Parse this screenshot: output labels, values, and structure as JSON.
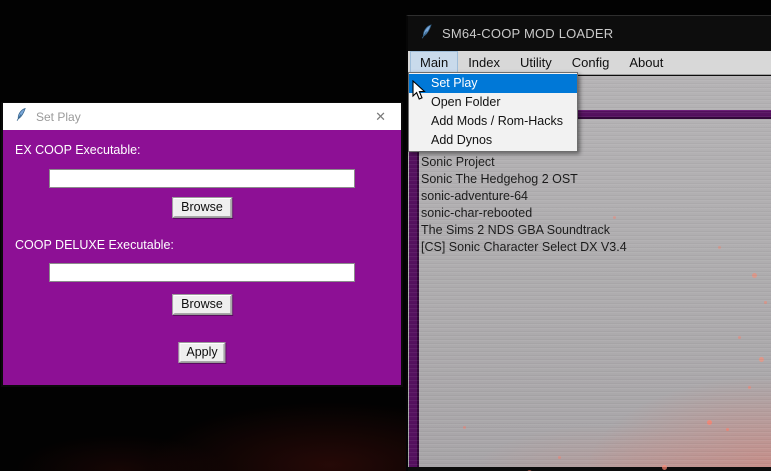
{
  "main_window": {
    "title": "SM64-COOP MOD LOADER",
    "menu_items": [
      "Main",
      "Index",
      "Utility",
      "Config",
      "About"
    ],
    "dropdown_items": [
      "Set Play",
      "Open Folder",
      "Add Mods / Rom-Hacks",
      "Add Dynos"
    ],
    "dropdown_selected": "Set Play",
    "list_items": [
      "Sonic Project",
      "Sonic The Hedgehog 2 OST",
      "sonic-adventure-64",
      "sonic-char-rebooted",
      "The Sims 2 NDS GBA Soundtrack",
      "[CS] Sonic Character Select DX V3.4"
    ]
  },
  "dialog": {
    "title": "Set Play",
    "close_glyph": "✕",
    "fields": [
      {
        "label": "EX COOP Executable:",
        "value": "",
        "browse_label": "Browse"
      },
      {
        "label": "COOP DELUXE Executable:",
        "value": "",
        "browse_label": "Browse"
      }
    ],
    "apply_label": "Apply"
  },
  "colors": {
    "dialog_purple": "#8d1095",
    "band_purple": "#55115f",
    "menu_highlight_blue": "#0078d7",
    "menubar_gray": "#d8d8d8",
    "client_gray": "#aeacae",
    "titlebar_black": "#0d0d0d"
  }
}
